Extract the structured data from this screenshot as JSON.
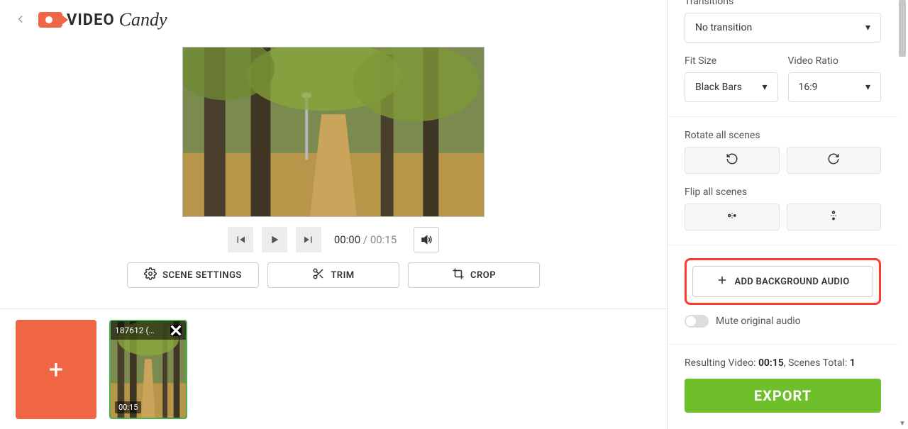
{
  "logo": {
    "word1": "VIDEO",
    "word2": "Candy"
  },
  "playback": {
    "current": "00:00",
    "separator": " / ",
    "duration": "00:15"
  },
  "tools": {
    "scene_settings": "SCENE SETTINGS",
    "trim": "TRIM",
    "crop": "CROP"
  },
  "timeline": {
    "clip": {
      "title": "187612 (…",
      "duration": "00:15"
    }
  },
  "panel": {
    "transitions_label": "Transitions",
    "transitions_value": "No transition",
    "fit_size_label": "Fit Size",
    "fit_size_value": "Black Bars",
    "video_ratio_label": "Video Ratio",
    "video_ratio_value": "16:9",
    "rotate_label": "Rotate all scenes",
    "flip_label": "Flip all scenes",
    "add_audio": "ADD BACKGROUND AUDIO",
    "mute_label": "Mute original audio"
  },
  "footer": {
    "prefix": "Resulting Video: ",
    "duration": "00:15",
    "mid": ", Scenes Total: ",
    "scenes": "1",
    "export": "EXPORT"
  }
}
